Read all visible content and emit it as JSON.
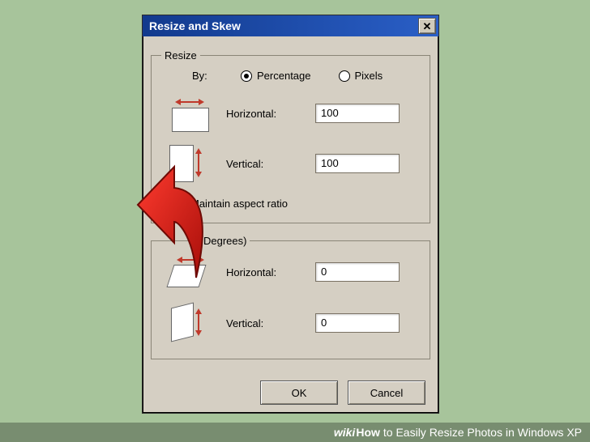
{
  "dialog": {
    "title": "Resize and Skew",
    "close_glyph": "✕"
  },
  "resize": {
    "legend": "Resize",
    "by_label": "By:",
    "percentage_label": "Percentage",
    "pixels_label": "Pixels",
    "horizontal_label": "Horizontal:",
    "horizontal_value": "100",
    "vertical_label": "Vertical:",
    "vertical_value": "100",
    "maintain_label": "Maintain aspect ratio",
    "maintain_check_glyph": "✓"
  },
  "skew": {
    "legend_visible": "Degrees)",
    "horizontal_label": "Horizontal:",
    "horizontal_value": "0",
    "vertical_label": "Vertical:",
    "vertical_value": "0"
  },
  "buttons": {
    "ok": "OK",
    "cancel": "Cancel"
  },
  "watermark": {
    "wiki": "wiki",
    "how": "How",
    "rest": " to Easily Resize Photos in Windows XP"
  }
}
